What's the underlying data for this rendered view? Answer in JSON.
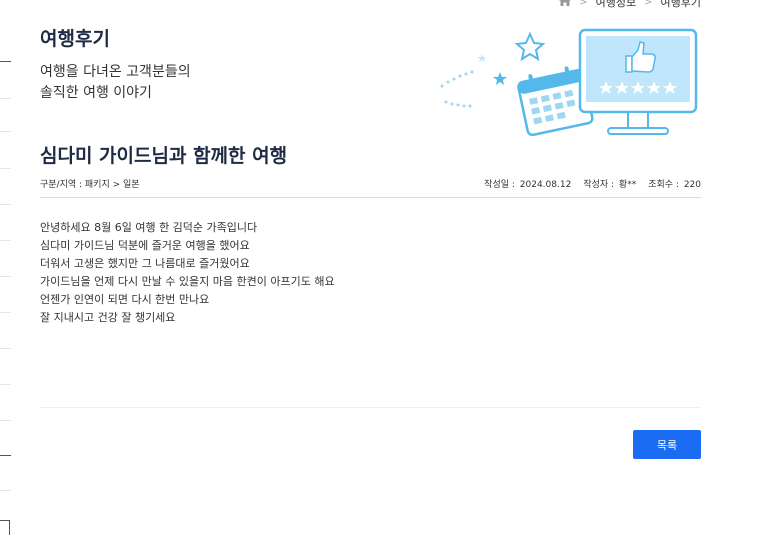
{
  "breadcrumb": {
    "items": [
      "여행정보",
      "여행후기"
    ]
  },
  "header": {
    "title": "여행후기",
    "subtitle_lines": [
      "여행을 다녀온 고객분들의",
      "솔직한 여행 이야기"
    ]
  },
  "post": {
    "title": "심다미 가이드님과 함께한 여행",
    "category": "구분/지역 : 패키지 > 일본",
    "meta": {
      "date_label": "작성일 :",
      "date": "2024.08.12",
      "author_label": "작성자 :",
      "author": "황**",
      "views_label": "조회수 :",
      "views": "220"
    },
    "body_lines": [
      "안녕하세요 8월 6일 여행 한 김덕순 가족입니다",
      "심다미 가이드님 덕분에 즐거운 여행을 했어요",
      "더워서 고생은 했지만 그 나름대로 즐거웠어요",
      "가이드님을 언제 다시 만날 수 있을지 마음 한켠이 아프기도 해요",
      "언젠가 인연이 되면 다시 한번 만나요",
      "잘 지내시고 건강 잘 챙기세요"
    ]
  },
  "actions": {
    "list_label": "목록"
  },
  "colors": {
    "accent": "#1a6cf2",
    "illustration_blue": "#55b8ea",
    "illustration_light": "#bfe6fa",
    "title": "#1f2a44"
  },
  "icons": {
    "home": "home-icon",
    "chevron": "chevron-right-icon",
    "illustration": "review-illustration"
  }
}
